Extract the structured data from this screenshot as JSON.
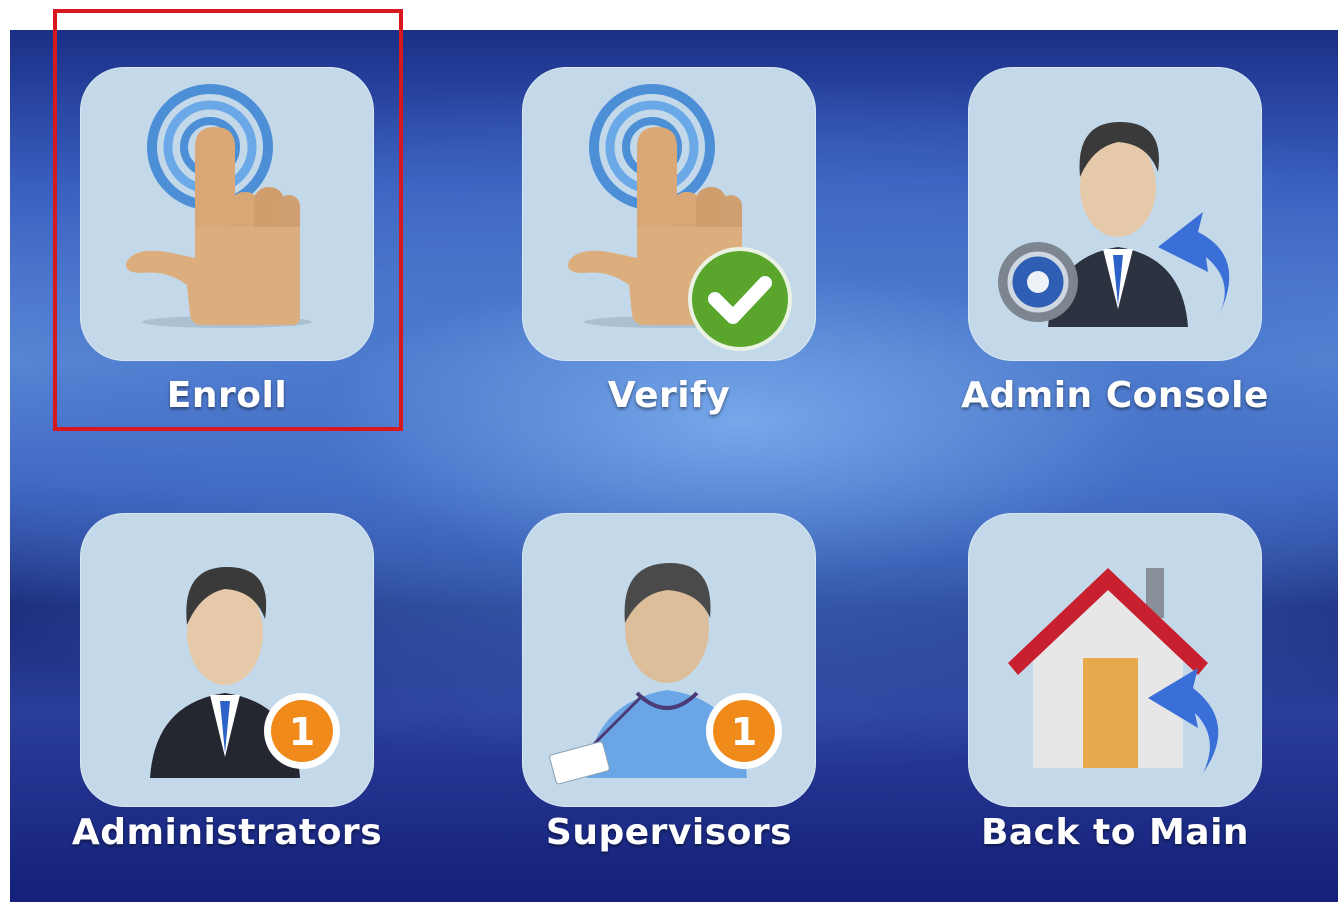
{
  "menu": {
    "items": [
      {
        "id": "enroll",
        "label": "Enroll",
        "icon": "fingerprint-touch-icon"
      },
      {
        "id": "verify",
        "label": "Verify",
        "icon": "fingerprint-verify-icon"
      },
      {
        "id": "admin_console",
        "label": "Admin Console",
        "icon": "admin-console-icon"
      },
      {
        "id": "administrators",
        "label": "Administrators",
        "icon": "administrator-icon",
        "badge": "1"
      },
      {
        "id": "supervisors",
        "label": "Supervisors",
        "icon": "supervisor-icon",
        "badge": "1"
      },
      {
        "id": "back_to_main",
        "label": "Back to Main",
        "icon": "home-back-icon"
      }
    ]
  },
  "highlight": {
    "target": "enroll",
    "color": "#d7191f"
  },
  "colors": {
    "tile": "#c3d9ea",
    "background": "#3a5fbf",
    "badge": "#f08a1a",
    "check": "#5aa52c",
    "roof": "#c8202e"
  }
}
